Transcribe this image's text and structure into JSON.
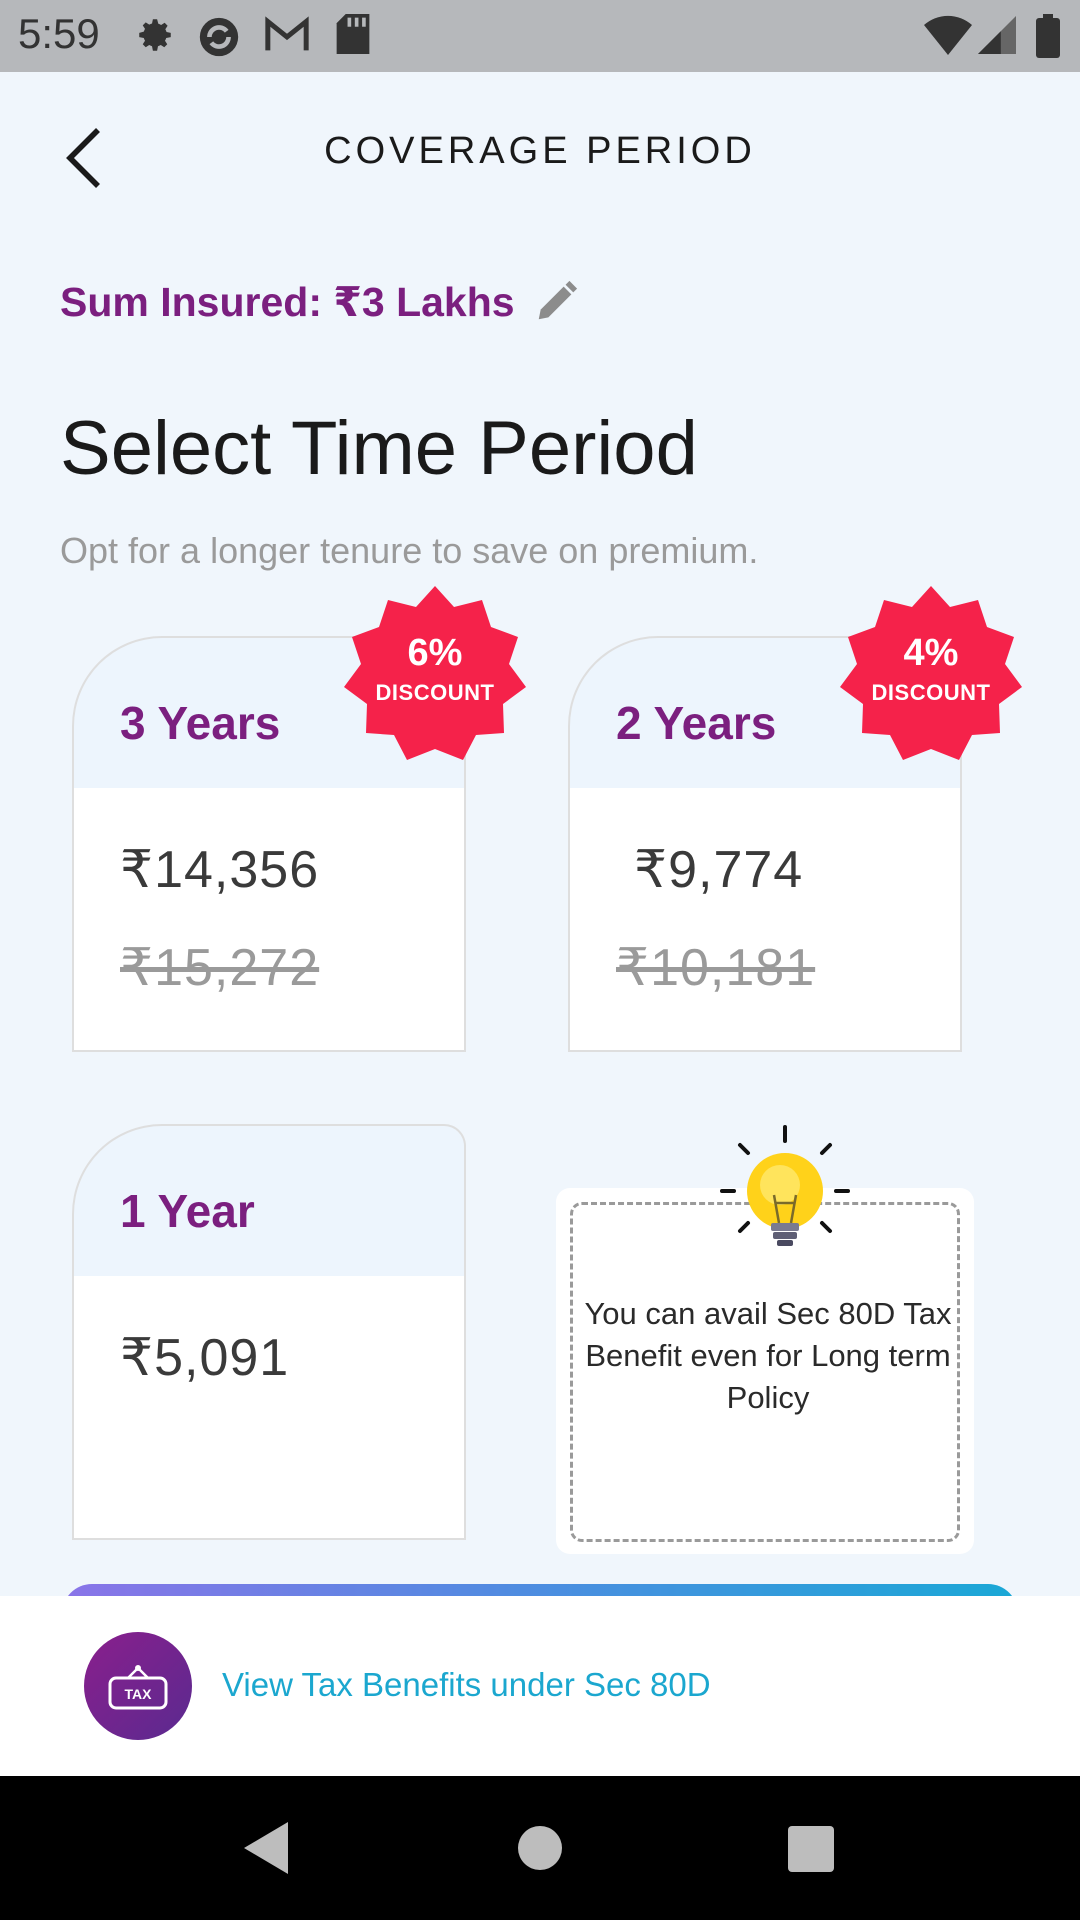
{
  "status_bar": {
    "time": "5:59",
    "icons": [
      "gear-icon",
      "sync-icon",
      "gmail-icon",
      "sd-card-icon",
      "wifi-icon",
      "signal-icon",
      "battery-icon"
    ]
  },
  "header": {
    "title": "COVERAGE PERIOD",
    "back_icon": "chevron-left-icon"
  },
  "sum_insured": {
    "label": "Sum Insured: ₹3 Lakhs",
    "edit_icon": "pencil-icon"
  },
  "section": {
    "title": "Select Time Period",
    "subtitle": "Opt for a longer tenure to save on premium."
  },
  "plans": [
    {
      "label": "3 Years",
      "price": "₹14,356",
      "old_price": "₹15,272",
      "discount_pct": "6%",
      "discount_word": "DISCOUNT"
    },
    {
      "label": "2 Years",
      "price": "₹9,774",
      "old_price": "₹10,181",
      "discount_pct": "4%",
      "discount_word": "DISCOUNT"
    },
    {
      "label": "1 Year",
      "price": "₹5,091"
    }
  ],
  "tip": {
    "icon": "lightbulb-icon",
    "text": "You can avail Sec 80D Tax Benefit even for Long term Policy"
  },
  "tax_bar": {
    "badge_text": "TAX",
    "link": "View Tax Benefits under Sec 80D"
  },
  "nav": {
    "back_icon": "nav-back-icon",
    "home_icon": "nav-home-icon",
    "recents_icon": "nav-recents-icon"
  },
  "colors": {
    "brand_purple": "#7b1f7f",
    "discount_red": "#f5224a",
    "link_blue": "#1ba7cf",
    "page_bg": "#f0f6fc"
  }
}
